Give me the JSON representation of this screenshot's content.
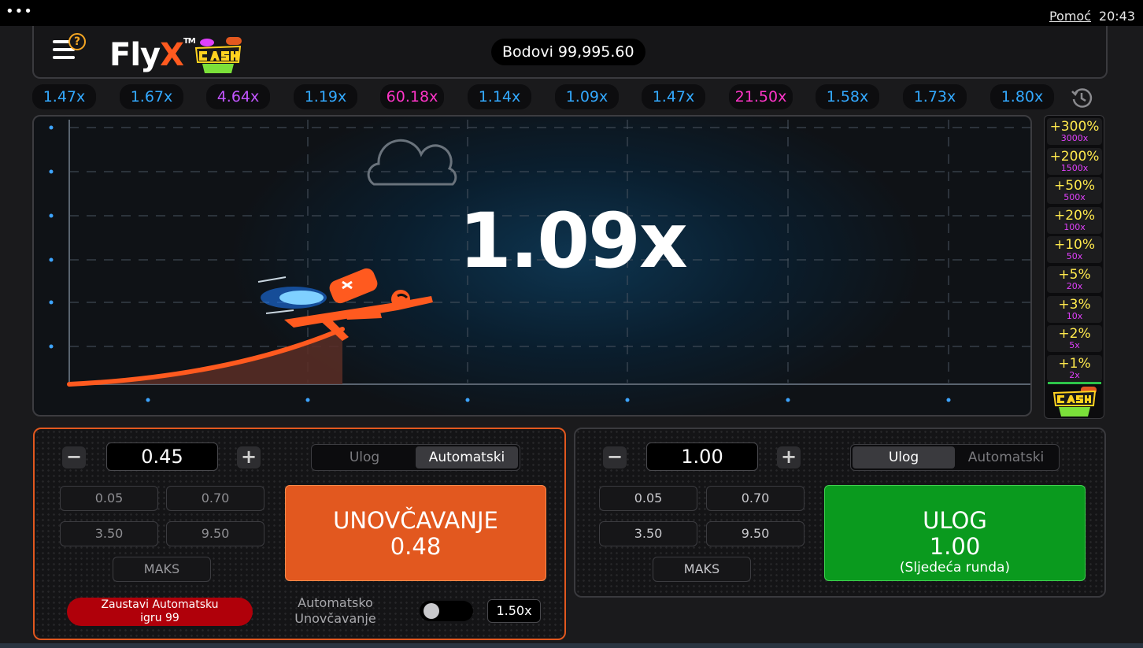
{
  "system": {
    "help_link": "Pomoć",
    "time": "20:43",
    "dots": "•••"
  },
  "header": {
    "logo_text": "Fly",
    "logo_x": "X",
    "logo_tm": "TM",
    "balance_label": "Bodovi 99,995.60"
  },
  "history": [
    {
      "value": "1.47x",
      "tone": "blue"
    },
    {
      "value": "1.67x",
      "tone": "blue"
    },
    {
      "value": "4.64x",
      "tone": "purple"
    },
    {
      "value": "1.19x",
      "tone": "blue"
    },
    {
      "value": "60.18x",
      "tone": "pink"
    },
    {
      "value": "1.14x",
      "tone": "blue"
    },
    {
      "value": "1.09x",
      "tone": "blue"
    },
    {
      "value": "1.47x",
      "tone": "blue"
    },
    {
      "value": "21.50x",
      "tone": "pink"
    },
    {
      "value": "1.58x",
      "tone": "blue"
    },
    {
      "value": "1.73x",
      "tone": "blue"
    },
    {
      "value": "1.80x",
      "tone": "blue"
    }
  ],
  "game": {
    "current_multiplier": "1.09x"
  },
  "ladder": [
    {
      "pct": "+300%",
      "mul": "3000x"
    },
    {
      "pct": "+200%",
      "mul": "1500x"
    },
    {
      "pct": "+50%",
      "mul": "500x"
    },
    {
      "pct": "+20%",
      "mul": "100x"
    },
    {
      "pct": "+10%",
      "mul": "50x"
    },
    {
      "pct": "+5%",
      "mul": "20x"
    },
    {
      "pct": "+3%",
      "mul": "10x"
    },
    {
      "pct": "+2%",
      "mul": "5x"
    },
    {
      "pct": "+1%",
      "mul": "2x"
    }
  ],
  "panel_left": {
    "minus": "−",
    "plus": "+",
    "amount": "0.45",
    "quick": [
      "0.05",
      "0.70",
      "3.50",
      "9.50"
    ],
    "max_label": "MAKS",
    "tab_bet": "Ulog",
    "tab_auto": "Automatski",
    "active_tab": "auto",
    "cashout_line1": "UNOVČAVANJE",
    "cashout_line2": "0.48",
    "stop_auto_line1": "Zaustavi Automatsku",
    "stop_auto_line2": "igru 99",
    "auto_cashout_line1": "Automatsko",
    "auto_cashout_line2": "Unovčavanje",
    "auto_cashout_enabled": false,
    "auto_cashout_value": "1.50x"
  },
  "panel_right": {
    "minus": "−",
    "plus": "+",
    "amount": "1.00",
    "quick": [
      "0.05",
      "0.70",
      "3.50",
      "9.50"
    ],
    "max_label": "MAKS",
    "tab_bet": "Ulog",
    "tab_auto": "Automatski",
    "active_tab": "bet",
    "bet_line1": "ULOG",
    "bet_line2": "1.00",
    "bet_line3": "(Sljedeća runda)"
  },
  "colors": {
    "accent_orange": "#e2581f",
    "bet_green": "#0a9a1e",
    "history_blue": "#33a9ff",
    "history_purple": "#c255ff",
    "history_pink": "#ff35c8"
  }
}
